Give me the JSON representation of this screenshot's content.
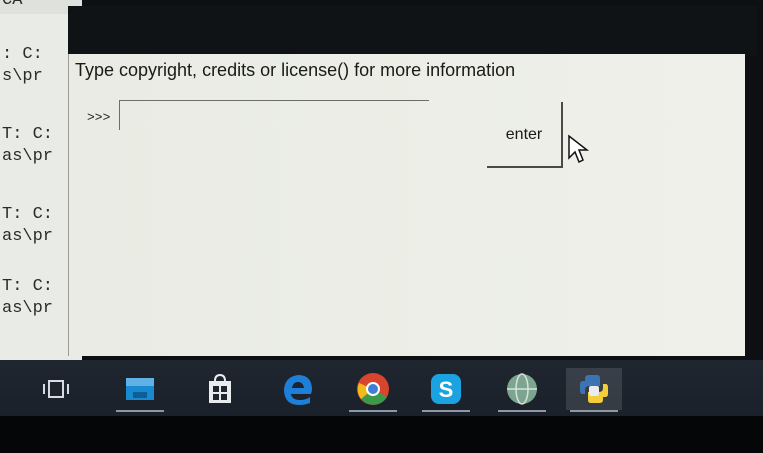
{
  "background_console": {
    "lines": [
      "CA",
      ": C:",
      "s\\pr",
      "T: C:",
      "as\\pr",
      "T: C:",
      "as\\pr",
      "T: C:",
      "as\\pr"
    ]
  },
  "app": {
    "info_text": "Type copyright, credits or license() for more information",
    "prompt": ">>>",
    "input_value": "",
    "enter_label": "enter"
  },
  "taskbar": {
    "items": [
      {
        "name": "task-view-icon",
        "running": false,
        "active": false
      },
      {
        "name": "file-explorer-icon",
        "running": true,
        "active": false
      },
      {
        "name": "store-icon",
        "running": false,
        "active": false
      },
      {
        "name": "edge-icon",
        "running": false,
        "active": false
      },
      {
        "name": "chrome-icon",
        "running": true,
        "active": false
      },
      {
        "name": "skype-icon",
        "running": true,
        "active": false
      },
      {
        "name": "globe-app-icon",
        "running": true,
        "active": false
      },
      {
        "name": "python-icon",
        "running": true,
        "active": true
      }
    ]
  },
  "colors": {
    "window_bg": "#ECEEE7",
    "taskbar_bg": "#1F2630",
    "edge_blue": "#1E7FD8",
    "skype_blue": "#1AA3E0"
  }
}
